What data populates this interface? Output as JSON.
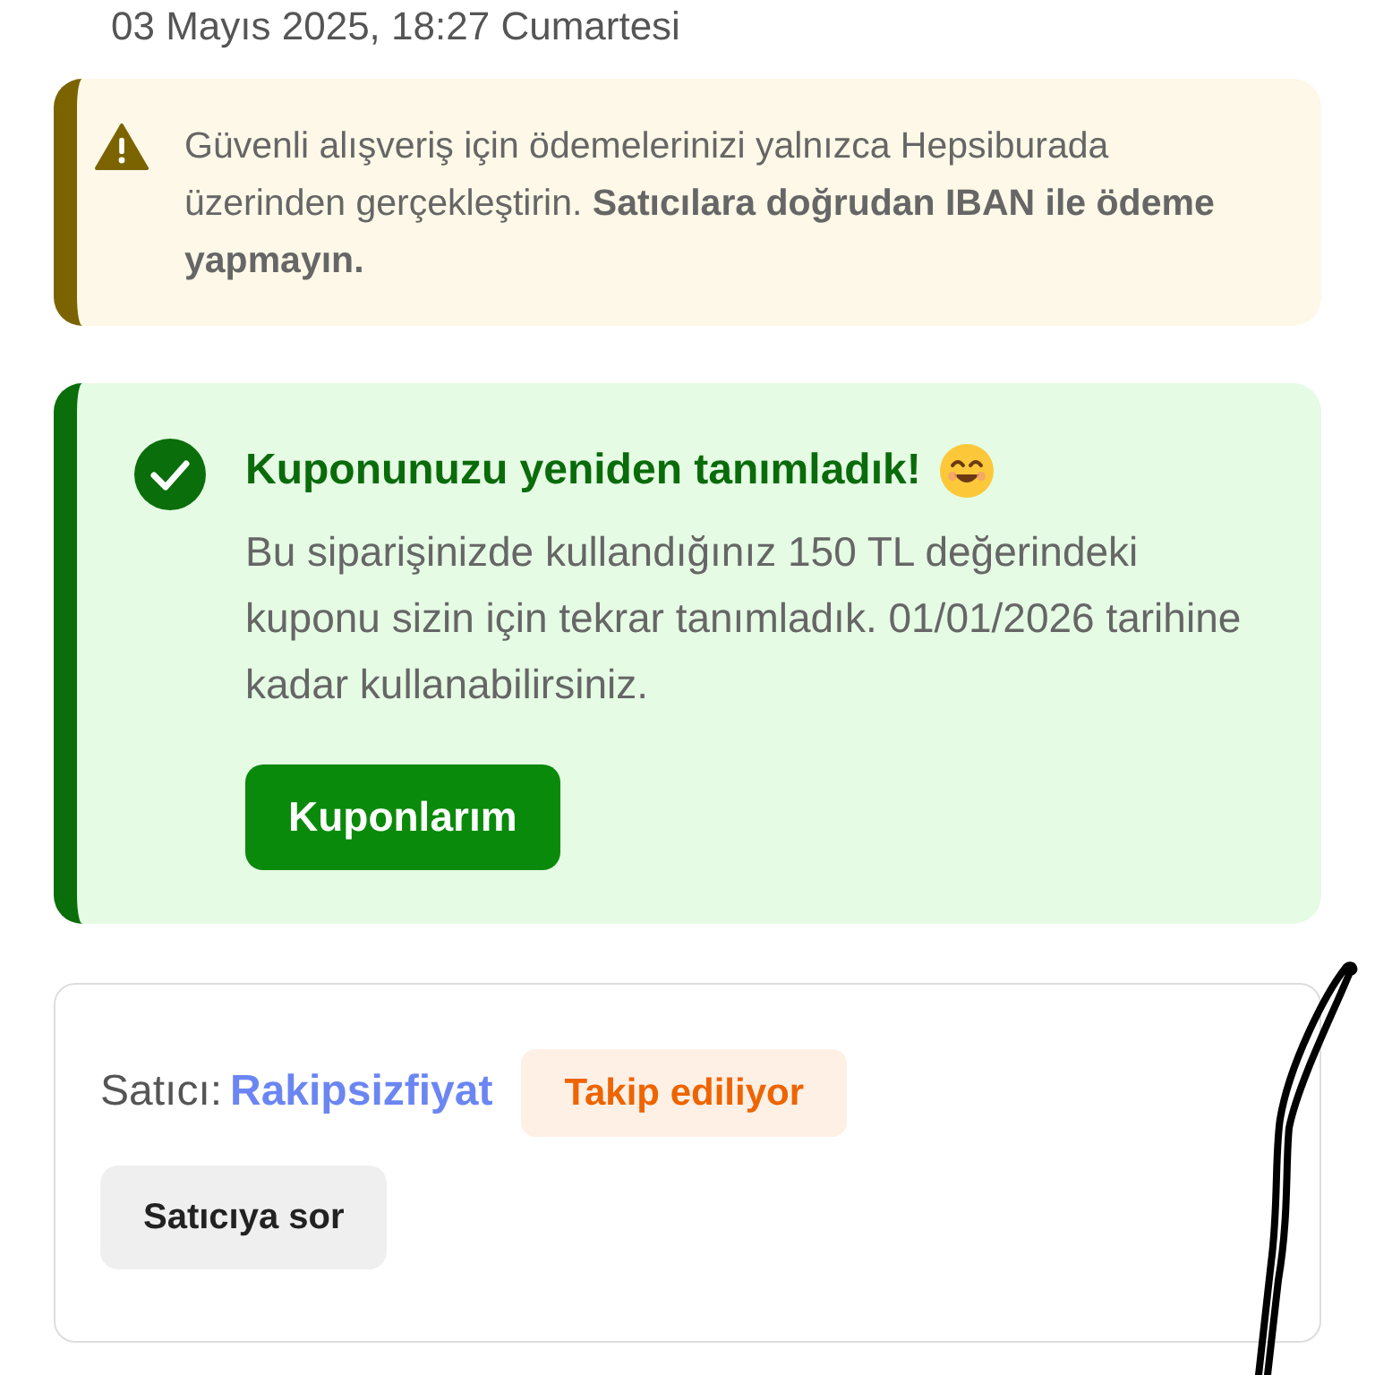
{
  "order_date": "03 Mayıs 2025, 18:27 Cumartesi",
  "warning": {
    "text": "Güvenli alışveriş için ödemelerinizi yalnızca Hepsiburada üzerinden gerçekleştirin. **Satıcılara doğrudan IBAN ile ödeme yapmayın.**"
  },
  "coupon_notice": {
    "title": "Kuponunuzu yeniden tanımladık!",
    "text": "Bu siparişinizde kullandığınız 150 TL değerindeki kuponu sizin için tekrar tanımladık. 01/01/2026 tarihine kadar kullanabilirsiniz.",
    "button": "Kuponlarım"
  },
  "seller": {
    "label": "Satıcı:",
    "name": "Rakipsizfiyat",
    "follow_badge": "Takip ediliyor",
    "button": "Satıcıya sor"
  }
}
